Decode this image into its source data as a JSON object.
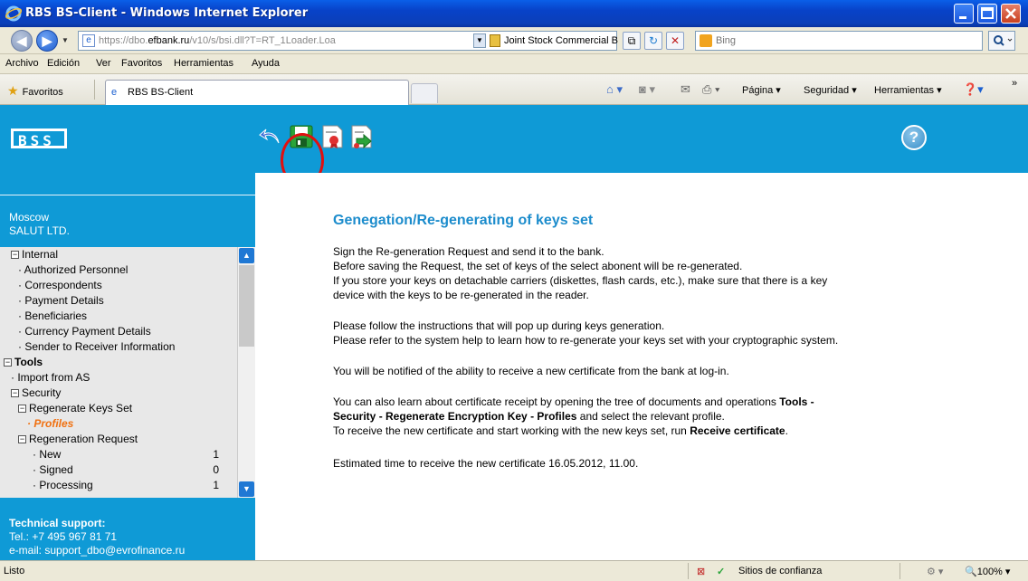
{
  "window": {
    "title": "RBS BS-Client - Windows Internet Explorer"
  },
  "address": {
    "url_prefix": "https://dbo.",
    "url_host": "efbank.ru",
    "url_rest": "/v10/s/bsi.dll?T=RT_1Loader.Loa",
    "site_name": "Joint Stock Commercial Bank Evrofinan...",
    "search_placeholder": "Bing"
  },
  "menu": [
    "Archivo",
    "Edición",
    "Ver",
    "Favoritos",
    "Herramientas",
    "Ayuda"
  ],
  "favbar": {
    "favorites_label": "Favoritos",
    "tab_title": "RBS BS-Client",
    "commands": [
      "Página ▾",
      "Seguridad ▾",
      "Herramientas ▾"
    ]
  },
  "app": {
    "logo": "BSS",
    "help_label": "?"
  },
  "sidebar": {
    "org_city": "Moscow",
    "org_name": "SALUT LTD.",
    "tree": [
      {
        "label": "Internal",
        "type": "group",
        "indent": 1
      },
      {
        "label": "Authorized Personnel",
        "type": "item",
        "indent": 2
      },
      {
        "label": "Correspondents",
        "type": "item",
        "indent": 2
      },
      {
        "label": "Payment Details",
        "type": "item",
        "indent": 2
      },
      {
        "label": "Beneficiaries",
        "type": "item",
        "indent": 2
      },
      {
        "label": "Currency Payment Details",
        "type": "item",
        "indent": 2
      },
      {
        "label": "Sender to Receiver Information",
        "type": "item",
        "indent": 2
      },
      {
        "label": "Tools",
        "type": "group-bold",
        "indent": 0
      },
      {
        "label": "Import from AS",
        "type": "item",
        "indent": 1
      },
      {
        "label": "Security",
        "type": "group",
        "indent": 1
      },
      {
        "label": "Regenerate Keys Set",
        "type": "group",
        "indent": 2
      },
      {
        "label": "Profiles",
        "type": "selected",
        "indent": 3
      },
      {
        "label": "Regeneration Request",
        "type": "group",
        "indent": 2
      },
      {
        "label": "New",
        "type": "item",
        "indent": 4,
        "value": "1"
      },
      {
        "label": "Signed",
        "type": "item",
        "indent": 4,
        "value": "0"
      },
      {
        "label": "Processing",
        "type": "item",
        "indent": 4,
        "value": "1"
      }
    ],
    "support_title": "Technical support:",
    "support_tel": "Tel.: +7 495 967 81 71",
    "support_email": "e-mail: support_dbo@evrofinance.ru"
  },
  "main": {
    "heading": "Genegation/Re-generating of keys set",
    "p1": [
      "Sign the Re-generation Request and send it to the bank.",
      "Before saving the Request, the set of keys of the select abonent will be re-generated.",
      "If you store your keys on detachable carriers (diskettes, flash cards, etc.), make sure that there is a key",
      "device with the keys to be re-generated in the reader."
    ],
    "p2": [
      "Please follow the instructions that will pop up during keys generation.",
      "Please refer to the system help to learn how to re-generate your keys set with your cryptographic system."
    ],
    "p3": "You will be notified of the ability to receive a new certificate from the bank at log-in.",
    "p4_line1": "You can also learn about certificate receipt by opening the tree of documents and operations",
    "p4_bold1": "Tools -",
    "p4_bold2": "Security - Regenerate Encryption Key - Profiles",
    "p4_line2_tail": "and select the relevant profile.",
    "p4_line3": "To receive the new certificate and start working with the new keys set, run",
    "p4_bold3": "Receive certificate",
    "p4_dot": ".",
    "p5": "Estimated time to receive the new certificate 16.05.2012, 11.00."
  },
  "status": {
    "left": "Listo",
    "zone": "Sitios de confianza",
    "zoom": "100%"
  }
}
